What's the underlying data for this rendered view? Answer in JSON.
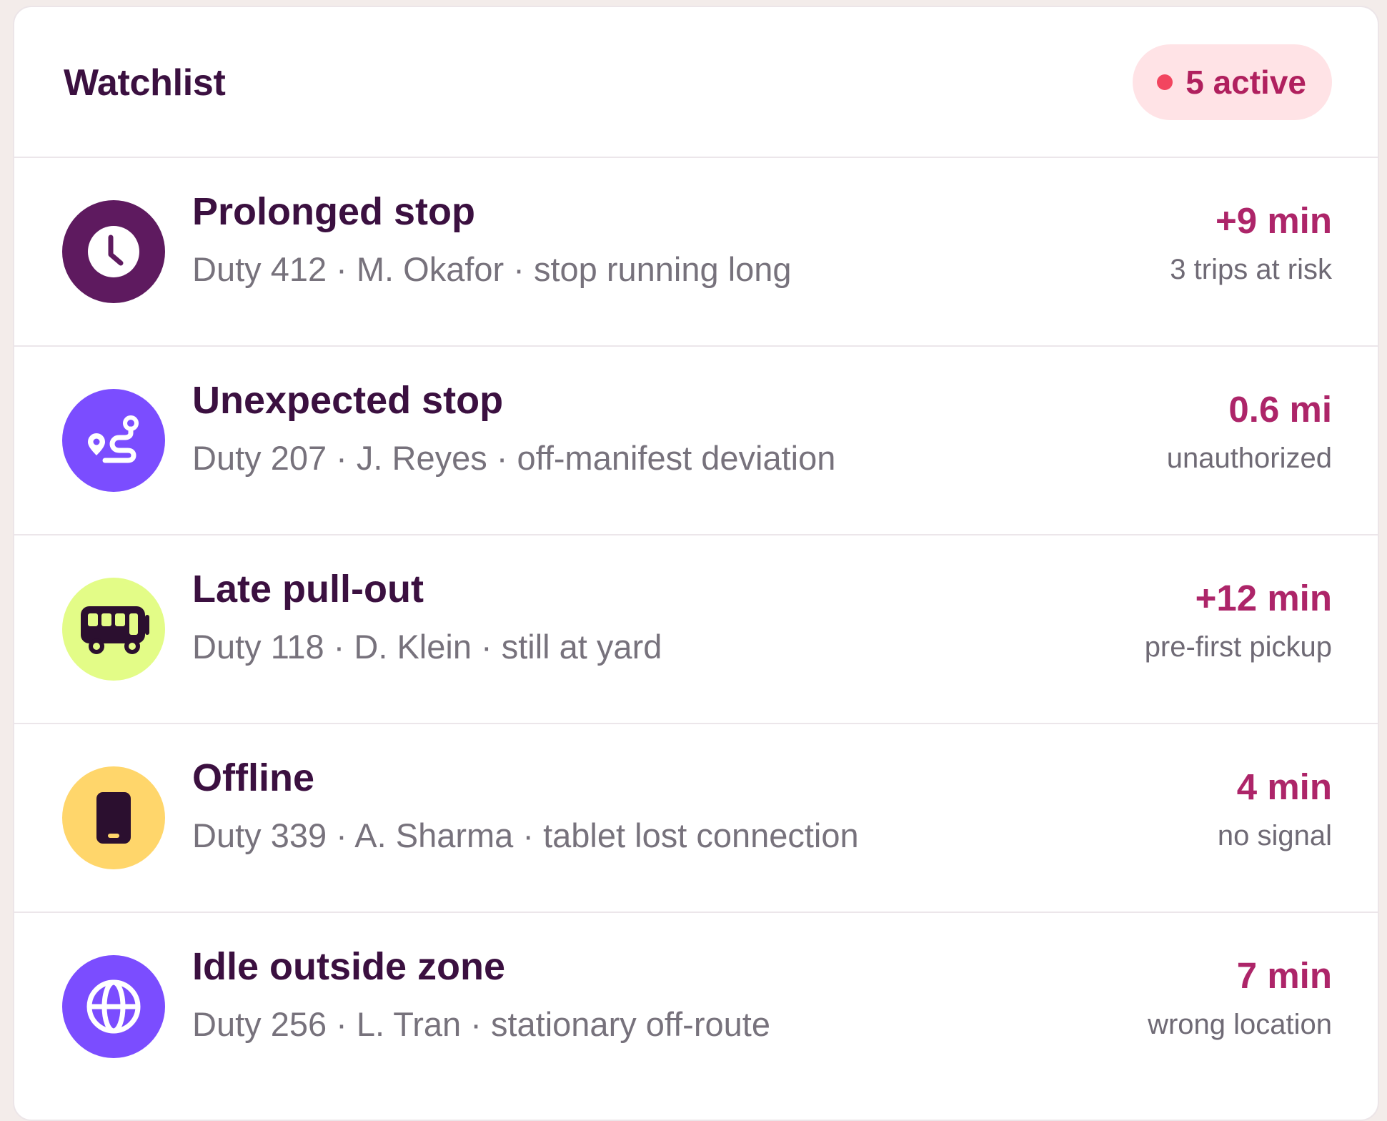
{
  "watchlist": {
    "title": "Watchlist",
    "badge": "5 active",
    "items": [
      {
        "title": "Prolonged stop",
        "subtitle": "Duty 412 · M. Okafor · stop running long",
        "value": "+9 min",
        "note": "3 trips at risk",
        "icon": "clock-icon",
        "icon_bg": "#5e1a5f"
      },
      {
        "title": "Unexpected stop",
        "subtitle": "Duty 207 · J. Reyes · off-manifest deviation",
        "value": "0.6 mi",
        "note": "unauthorized",
        "icon": "route-icon",
        "icon_bg": "#7b4dff"
      },
      {
        "title": "Late pull-out",
        "subtitle": "Duty 118 · D. Klein · still at yard",
        "value": "+12 min",
        "note": "pre-first pickup",
        "icon": "bus-icon",
        "icon_bg": "#e3fc87"
      },
      {
        "title": "Offline",
        "subtitle": "Duty 339 · A. Sharma · tablet lost connection",
        "value": "4 min",
        "note": "no signal",
        "icon": "tablet-icon",
        "icon_bg": "#ffd66b"
      },
      {
        "title": "Idle outside zone",
        "subtitle": "Duty 256 · L. Tran · stationary off-route",
        "value": "7 min",
        "note": "wrong location",
        "icon": "globe-icon",
        "icon_bg": "#7b4dff"
      }
    ]
  },
  "colors": {
    "title": "#3b1040",
    "accent": "#ad2569",
    "badge_bg": "#ffe3e6",
    "badge_dot": "#f2455f",
    "muted": "#77727c"
  }
}
